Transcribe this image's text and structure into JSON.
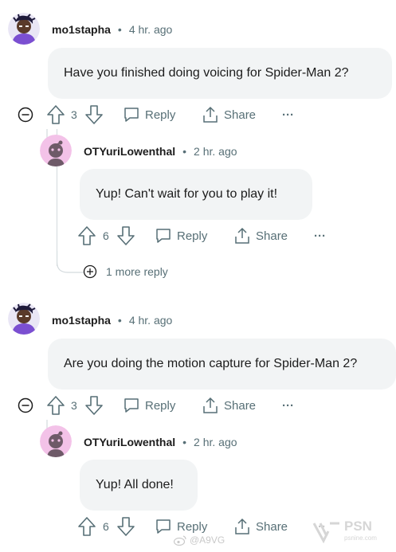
{
  "threads": [
    {
      "comment": {
        "user": "mo1stapha",
        "time": "4 hr. ago",
        "text": "Have you finished doing voicing for Spider-Man 2?",
        "votes": "3",
        "reply_label": "Reply",
        "share_label": "Share",
        "more_label": "···"
      },
      "reply": {
        "user": "OTYuriLowenthal",
        "time": "2 hr. ago",
        "text": "Yup! Can't wait for you to play it!",
        "votes": "6",
        "reply_label": "Reply",
        "share_label": "Share",
        "more_label": "···"
      },
      "more_replies": "1 more reply"
    },
    {
      "comment": {
        "user": "mo1stapha",
        "time": "4 hr. ago",
        "text": "Are you doing the motion capture for Spider-Man 2?",
        "votes": "3",
        "reply_label": "Reply",
        "share_label": "Share",
        "more_label": "···"
      },
      "reply": {
        "user": "OTYuriLowenthal",
        "time": "2 hr. ago",
        "text": "Yup! All done!",
        "votes": "6",
        "reply_label": "Reply",
        "share_label": "Share",
        "more_label": "···"
      }
    }
  ],
  "separator": "•",
  "watermark": {
    "weibo": "@A9VG",
    "psn": "PSN",
    "psn_sub": "psnine.com"
  },
  "colors": {
    "bubble": "#f2f4f5",
    "meta_gray": "#576f76",
    "thread_line": "#d3dadd",
    "avatar_pink": "#f3c2e8",
    "avatar_purple": "#7b4fd1"
  }
}
